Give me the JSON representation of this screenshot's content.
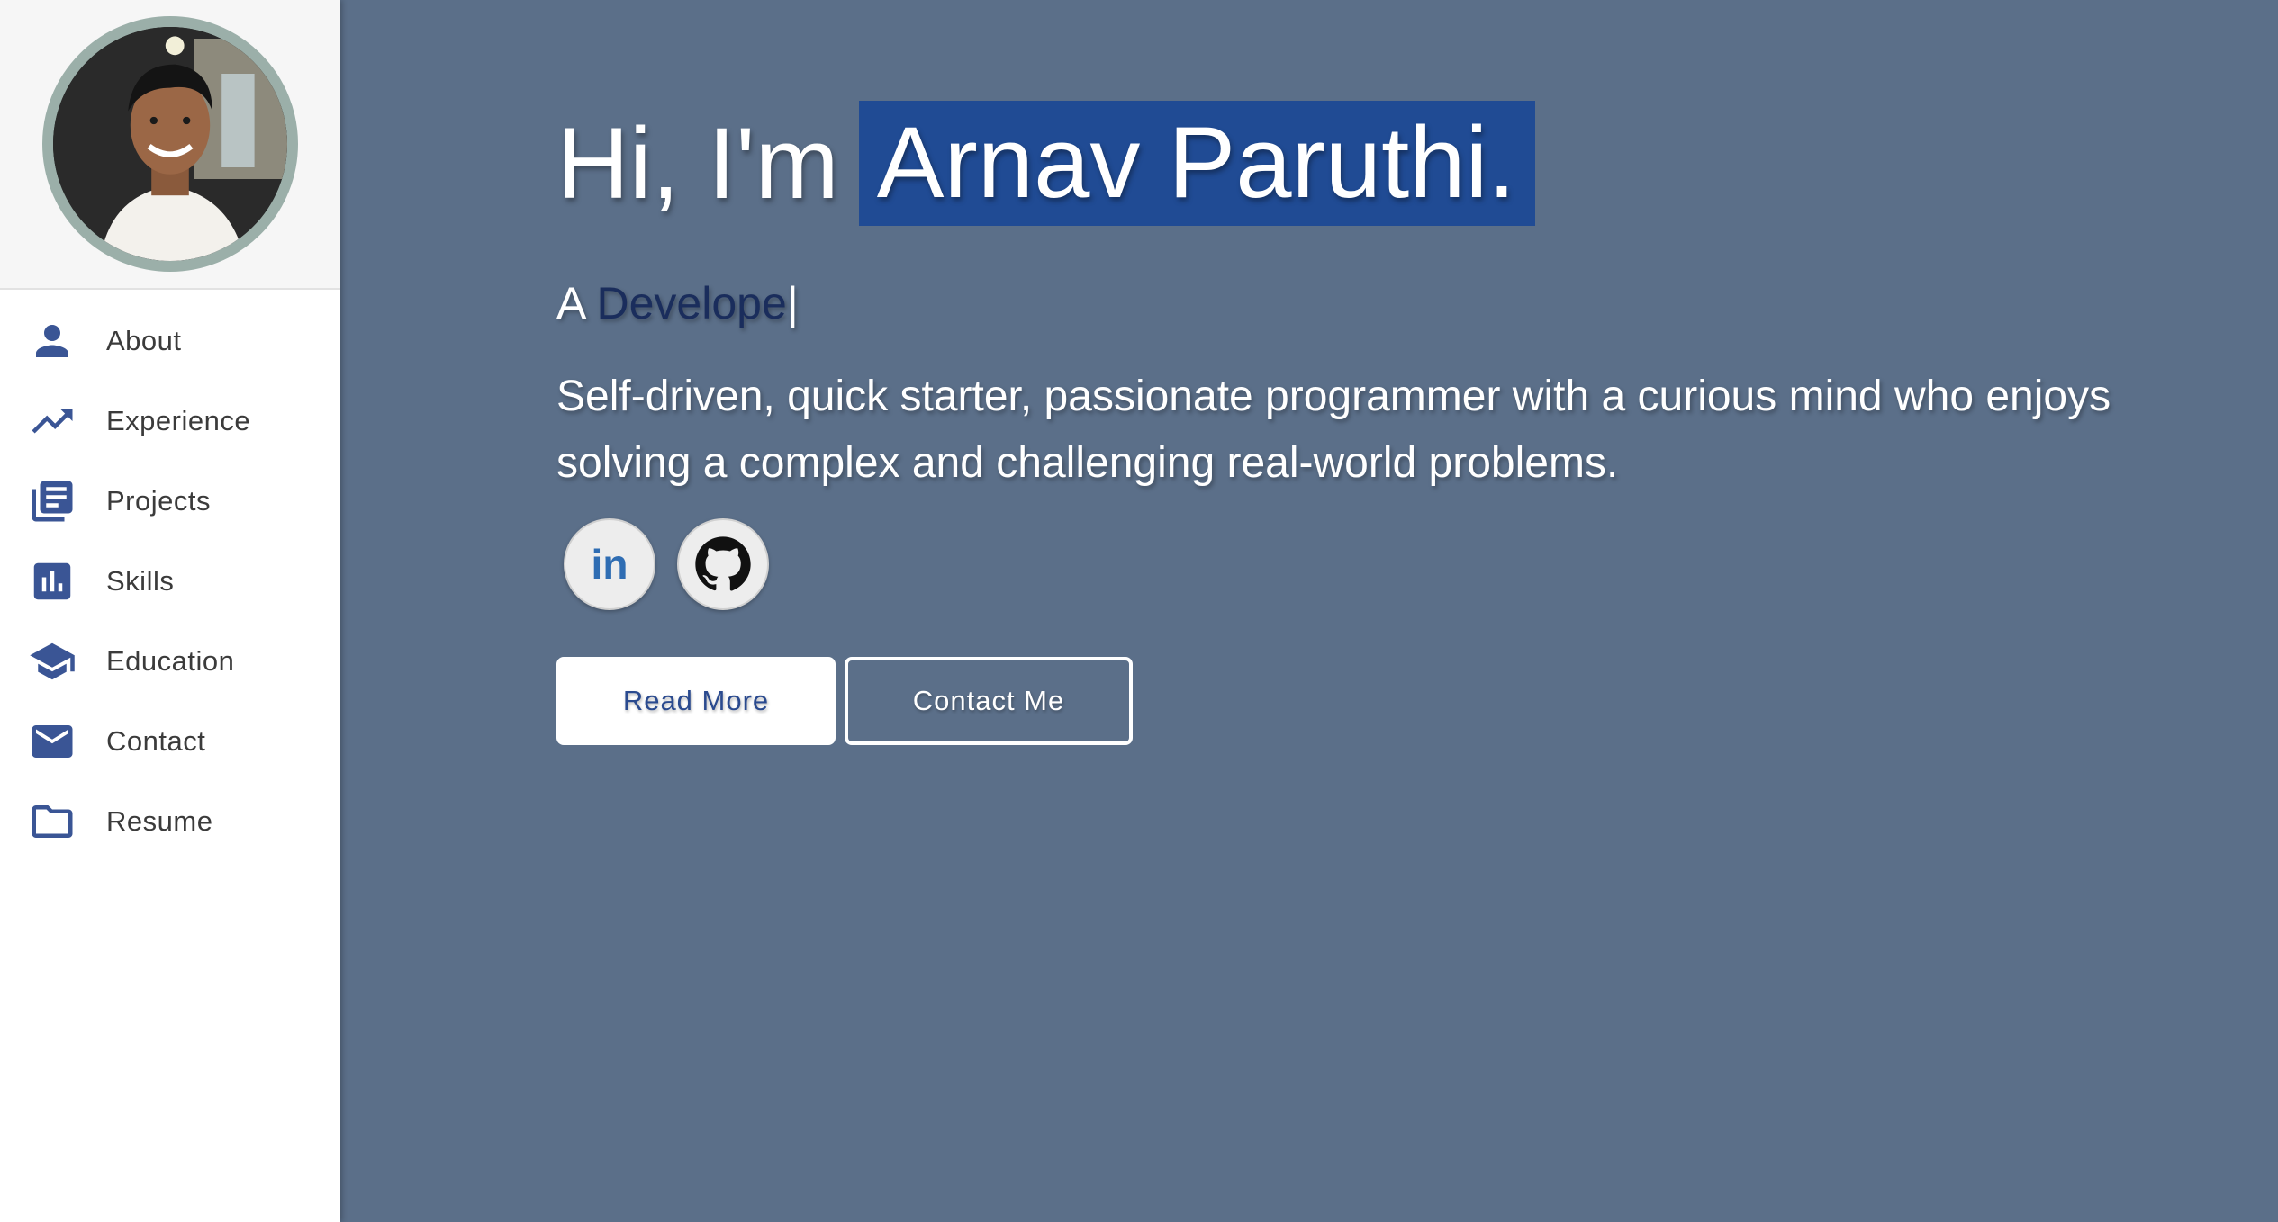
{
  "profile": {
    "avatar_alt": "Arnav Paruthi"
  },
  "nav": {
    "items": [
      {
        "label": "About",
        "icon": "person-icon"
      },
      {
        "label": "Experience",
        "icon": "trending-up-icon"
      },
      {
        "label": "Projects",
        "icon": "library-books-icon"
      },
      {
        "label": "Skills",
        "icon": "bar-chart-icon"
      },
      {
        "label": "Education",
        "icon": "school-icon"
      },
      {
        "label": "Contact",
        "icon": "mail-icon"
      },
      {
        "label": "Resume",
        "icon": "folder-icon"
      }
    ]
  },
  "hero": {
    "greeting": "Hi, I'm",
    "name": "Arnav Paruthi.",
    "role_prefix": "A",
    "role_typed": "Develope",
    "cursor": "|",
    "bio": "Self-driven, quick starter, passionate programmer with a curious mind who enjoys solving a complex and challenging real-world problems.",
    "socials": [
      {
        "label": "in",
        "icon": "linkedin-icon"
      },
      {
        "label": "",
        "icon": "github-icon"
      }
    ],
    "read_more_label": "Read More",
    "contact_label": "Contact Me"
  },
  "colors": {
    "main_background": "#5b6f89",
    "name_highlight": "#204b94",
    "role_text": "#1a2d5c",
    "nav_icon": "#3a5595",
    "avatar_ring": "#9bafa9"
  }
}
